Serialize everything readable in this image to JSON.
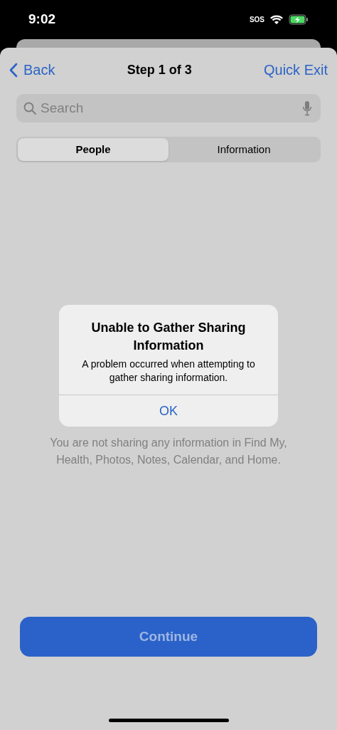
{
  "status_bar": {
    "time": "9:02",
    "carrier": "SOS"
  },
  "nav": {
    "back": "Back",
    "title": "Step 1 of 3",
    "action": "Quick Exit"
  },
  "search": {
    "placeholder": "Search"
  },
  "tabs": [
    {
      "label": "People",
      "selected": true
    },
    {
      "label": "Information",
      "selected": false
    }
  ],
  "message": "You are not sharing any information in Find My, Health, Photos, Notes, Calendar, and Home.",
  "alert": {
    "title": "Unable to Gather Sharing Information",
    "body": "A problem occurred when attempting to gather sharing information.",
    "buttons": [
      "OK"
    ]
  },
  "continue_button": {
    "label": "Continue",
    "disabled": true
  }
}
